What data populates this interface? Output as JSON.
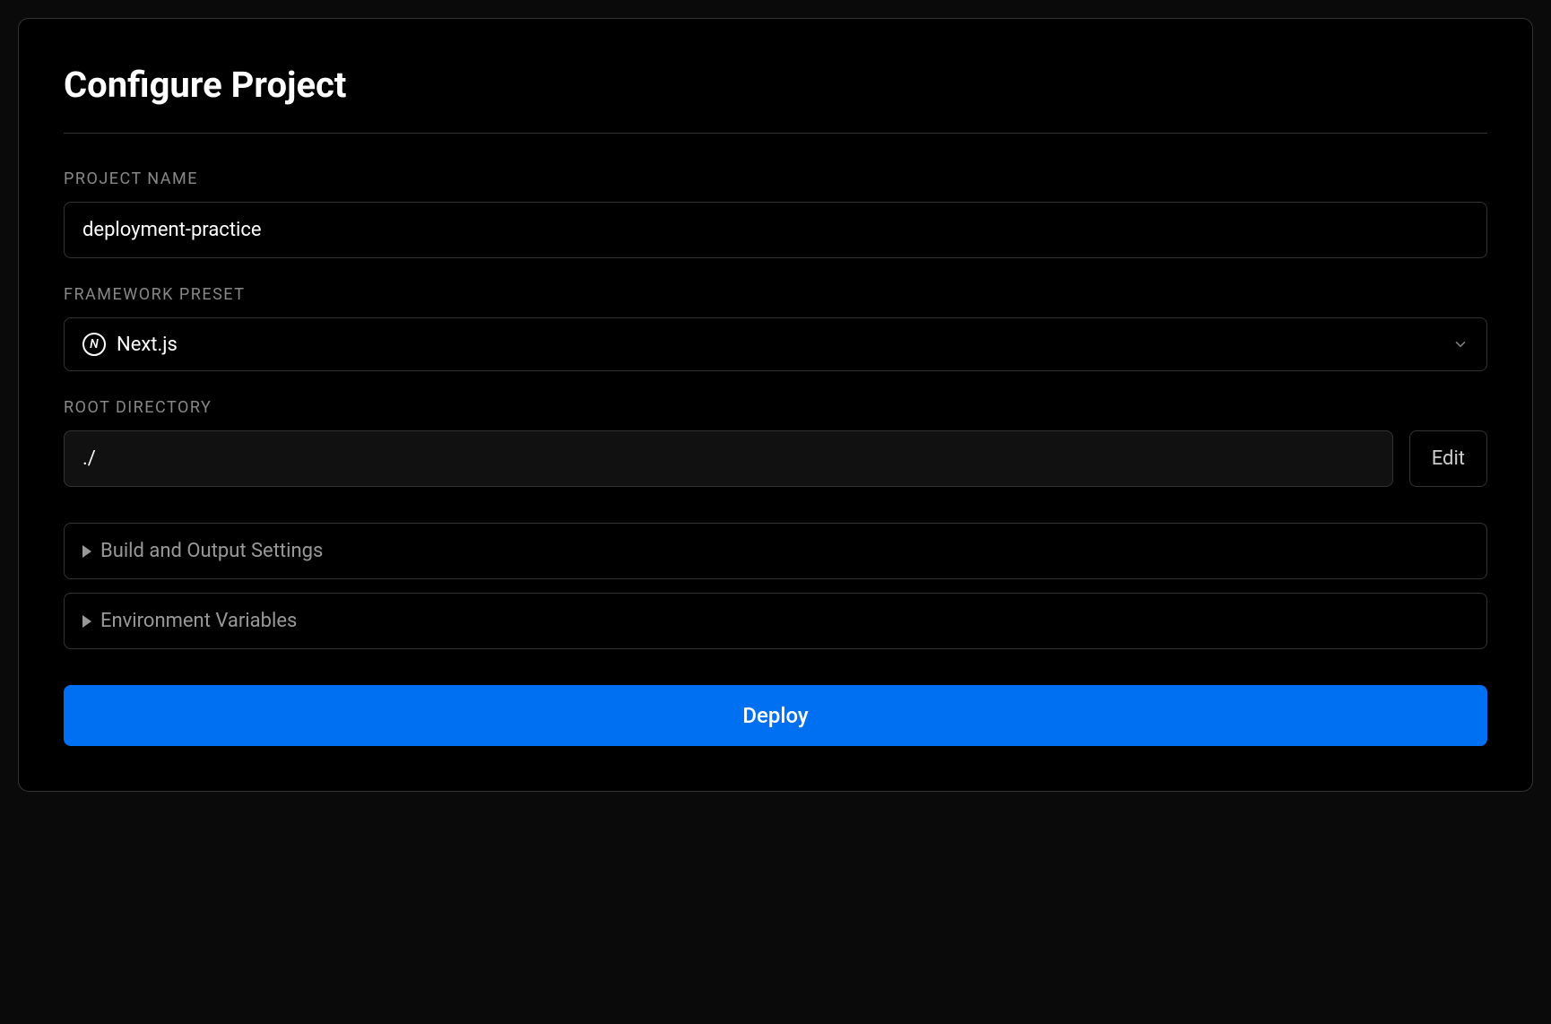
{
  "title": "Configure Project",
  "fields": {
    "project_name": {
      "label": "PROJECT NAME",
      "value": "deployment-practice"
    },
    "framework_preset": {
      "label": "FRAMEWORK PRESET",
      "selected": "Next.js",
      "icon_letter": "N"
    },
    "root_directory": {
      "label": "ROOT DIRECTORY",
      "value": "./",
      "edit_button": "Edit"
    }
  },
  "collapsibles": {
    "build_output": "Build and Output Settings",
    "env_vars": "Environment Variables"
  },
  "actions": {
    "deploy": "Deploy"
  }
}
